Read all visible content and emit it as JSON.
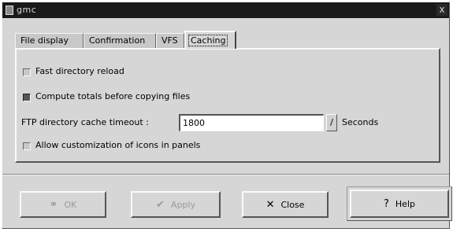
{
  "window": {
    "title": "gmc",
    "close_glyph": "x"
  },
  "tabs": [
    {
      "label": "File display",
      "active": false
    },
    {
      "label": "Confirmation",
      "active": false
    },
    {
      "label": "VFS",
      "active": false
    },
    {
      "label": "Caching",
      "active": true
    }
  ],
  "caching": {
    "fast_reload": {
      "label": "Fast directory reload",
      "checked": false
    },
    "compute_totals": {
      "label": "Compute totals before copying files",
      "checked": true
    },
    "ftp_cache": {
      "label": "FTP directory cache timeout :",
      "value": "1800",
      "unit": "Seconds",
      "spin_glyph": "/"
    },
    "icon_custom": {
      "label": "Allow customization of icons in panels",
      "checked": false
    }
  },
  "buttons": {
    "ok": {
      "label": "OK",
      "icon": "ok-icon",
      "enabled": false
    },
    "apply": {
      "label": "Apply",
      "icon": "apply-check-icon",
      "enabled": false
    },
    "close": {
      "label": "Close",
      "icon": "close-x-icon",
      "enabled": true
    },
    "help": {
      "label": "Help",
      "icon": "help-question-icon",
      "enabled": true
    }
  }
}
